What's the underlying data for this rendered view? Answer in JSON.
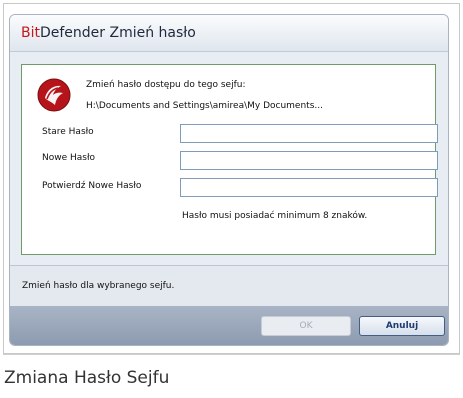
{
  "dialog": {
    "title_brand": "Bit",
    "title_rest": "Defender Zmień hasło",
    "intro_text": "Zmień hasło dostępu do tego sejfu:",
    "path_text": "H:\\Documents and Settings\\amirea\\My Documents...",
    "labels": {
      "old": "Stare Hasło",
      "new": "Nowe Hasło",
      "confirm": "Potwierdź Nowe Hasło"
    },
    "fields": {
      "old": "",
      "new": "",
      "confirm": ""
    },
    "hint_text": "Hasło musi posiadać minimum 8 znaków.",
    "status_text": "Zmień hasło dla wybranego sejfu.",
    "buttons": {
      "ok": "OK",
      "cancel": "Anuluj"
    }
  },
  "caption": "Zmiana Hasło Sejfu",
  "colors": {
    "brand": "#c8161d",
    "content_border": "#6f9b68"
  },
  "icons": {
    "logo": "bitdefender-logo-icon"
  }
}
